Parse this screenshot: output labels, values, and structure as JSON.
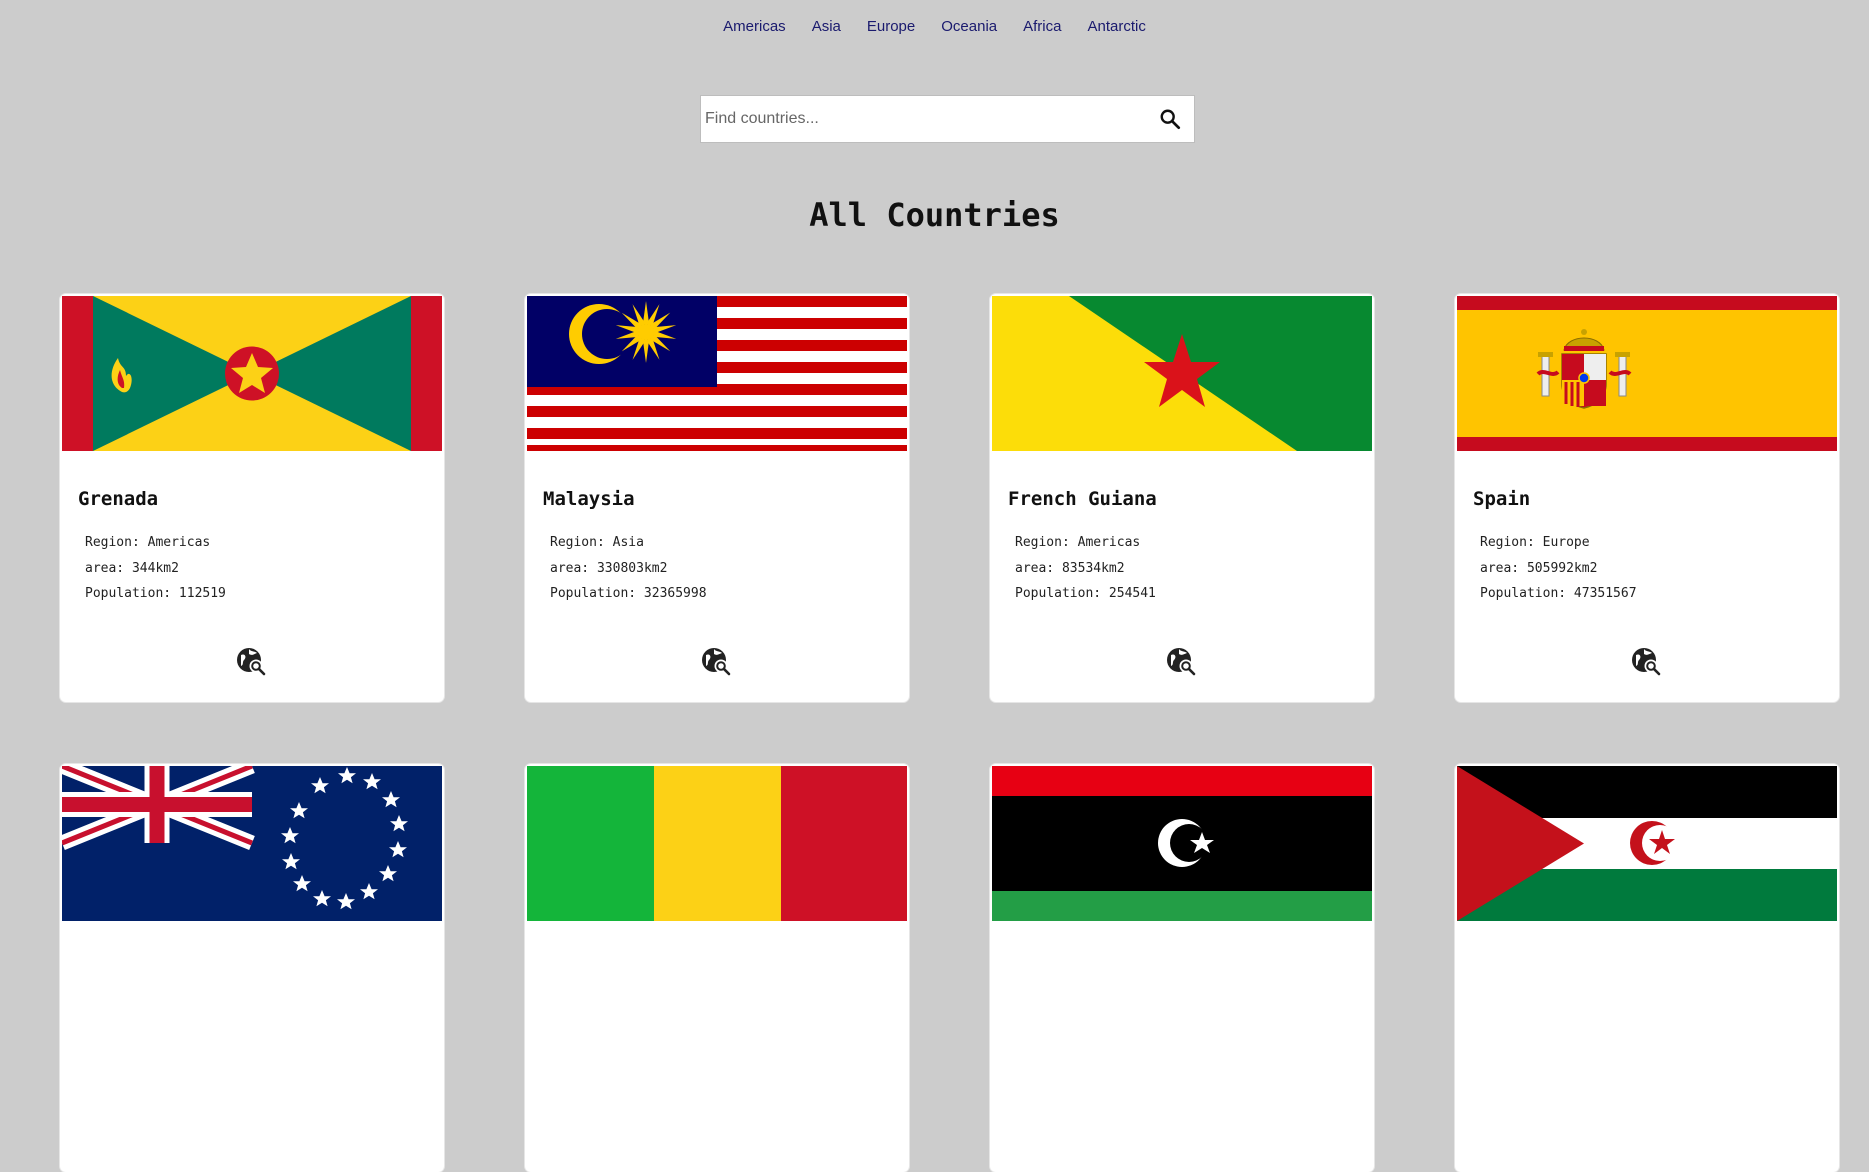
{
  "nav": [
    "Americas",
    "Asia",
    "Europe",
    "Oceania",
    "Africa",
    "Antarctic"
  ],
  "search": {
    "placeholder": "Find countries...",
    "icon": "search-icon"
  },
  "heading": "All Countries",
  "labels": {
    "region": "Region: ",
    "area": "area: ",
    "population": "Population: ",
    "area_unit": "km2"
  },
  "countries": [
    {
      "name": "Grenada",
      "region": "Americas",
      "area": "344",
      "population": "112519",
      "flag": "grenada"
    },
    {
      "name": "Malaysia",
      "region": "Asia",
      "area": "330803",
      "population": "32365998",
      "flag": "malaysia"
    },
    {
      "name": "French Guiana",
      "region": "Americas",
      "area": "83534",
      "population": "254541",
      "flag": "french-guiana"
    },
    {
      "name": "Spain",
      "region": "Europe",
      "area": "505992",
      "population": "47351567",
      "flag": "spain"
    },
    {
      "name": "",
      "region": "",
      "area": "",
      "population": "",
      "flag": "cook-islands"
    },
    {
      "name": "",
      "region": "",
      "area": "",
      "population": "",
      "flag": "mali"
    },
    {
      "name": "",
      "region": "",
      "area": "",
      "population": "",
      "flag": "libya"
    },
    {
      "name": "",
      "region": "",
      "area": "",
      "population": "",
      "flag": "western-sahara"
    }
  ],
  "colors": {
    "background": "#cccccc",
    "nav_link": "#1a1a6e"
  }
}
